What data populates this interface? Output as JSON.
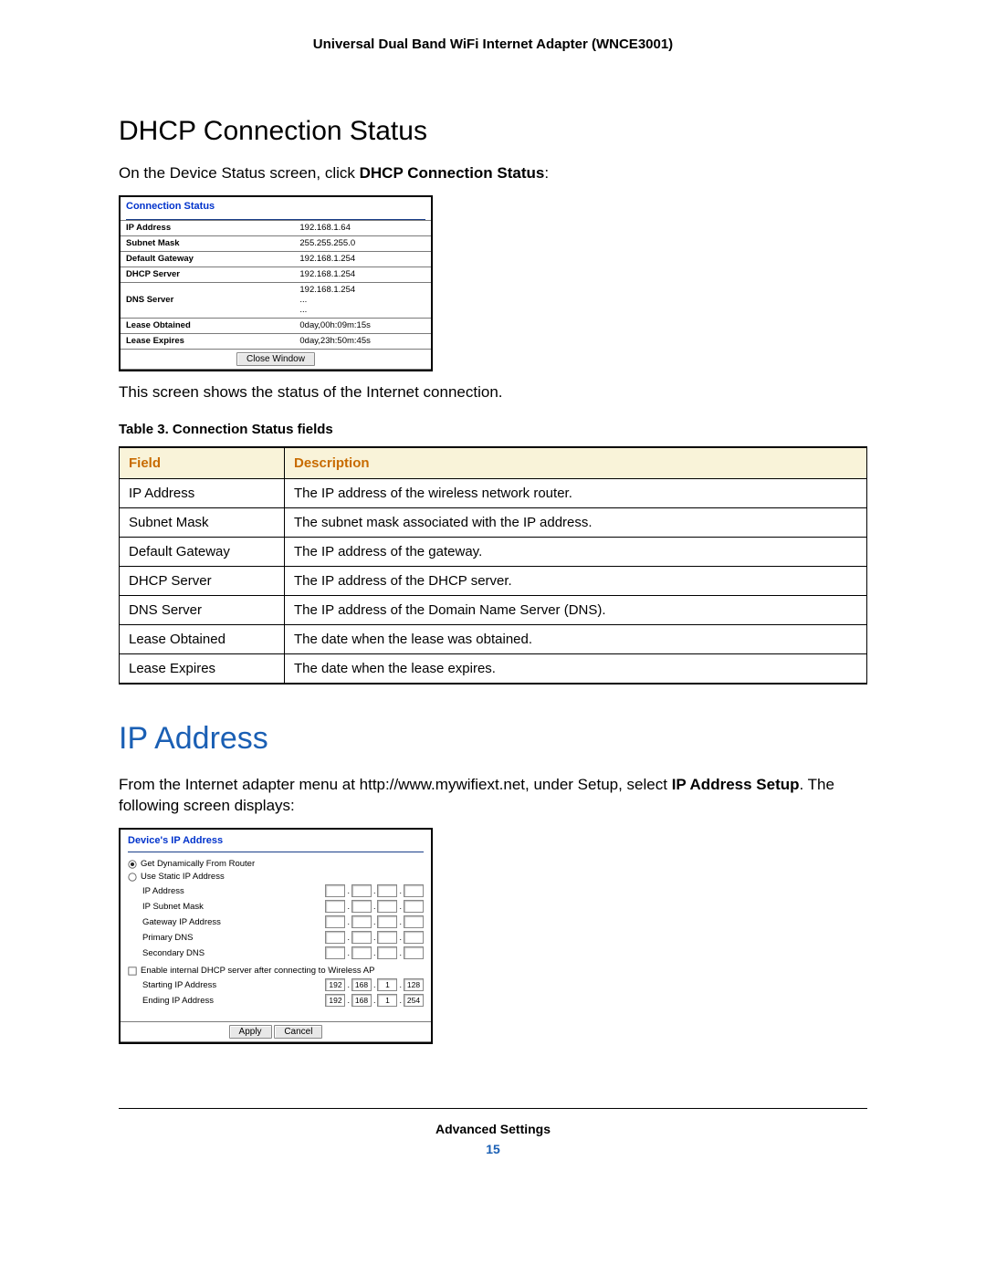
{
  "header": {
    "title": "Universal Dual Band WiFi Internet Adapter (WNCE3001)"
  },
  "section1": {
    "heading": "DHCP Connection Status",
    "intro_pre": "On the Device Status screen, click ",
    "intro_bold": "DHCP Connection Status",
    "intro_post": ":",
    "status_box": {
      "title": "Connection Status",
      "rows": [
        {
          "label": "IP Address",
          "value": "192.168.1.64"
        },
        {
          "label": "Subnet Mask",
          "value": "255.255.255.0"
        },
        {
          "label": "Default Gateway",
          "value": "192.168.1.254"
        },
        {
          "label": "DHCP Server",
          "value": "192.168.1.254"
        },
        {
          "label": "DNS Server",
          "value": "192.168.1.254\n...\n..."
        },
        {
          "label": "Lease Obtained",
          "value": "0day,00h:09m:15s"
        },
        {
          "label": "Lease Expires",
          "value": "0day,23h:50m:45s"
        }
      ],
      "close_label": "Close Window"
    },
    "after_box": "This screen shows the status of the Internet connection.",
    "table_caption": "Table 3.  Connection Status fields",
    "desc_table": {
      "headers": [
        "Field",
        "Description"
      ],
      "rows": [
        [
          "IP Address",
          "The IP address of the wireless network router."
        ],
        [
          "Subnet Mask",
          "The subnet mask associated with the IP address."
        ],
        [
          "Default Gateway",
          "The IP address of the gateway."
        ],
        [
          "DHCP Server",
          "The IP address of the DHCP server."
        ],
        [
          "DNS Server",
          "The IP address of the Domain Name Server (DNS)."
        ],
        [
          "Lease Obtained",
          "The date when the lease was obtained."
        ],
        [
          "Lease Expires",
          "The date when the lease expires."
        ]
      ]
    }
  },
  "section2": {
    "heading": "IP Address",
    "intro_pre": "From the Internet adapter menu at http://www.mywifiext.net, under Setup, select ",
    "intro_bold": "IP Address Setup",
    "intro_post": ". The following screen displays:",
    "ip_box": {
      "title": "Device's IP Address",
      "radio1": "Get Dynamically From Router",
      "radio2": "Use Static IP Address",
      "fields": [
        "IP Address",
        "IP Subnet Mask",
        "Gateway IP Address",
        "Primary DNS",
        "Secondary DNS"
      ],
      "checkbox": "Enable internal DHCP server after connecting to Wireless AP",
      "start_label": "Starting IP Address",
      "start_ip": [
        "192",
        "168",
        "1",
        "128"
      ],
      "end_label": "Ending IP Address",
      "end_ip": [
        "192",
        "168",
        "1",
        "254"
      ],
      "apply": "Apply",
      "cancel": "Cancel"
    }
  },
  "footer": {
    "text": "Advanced Settings",
    "page": "15"
  }
}
